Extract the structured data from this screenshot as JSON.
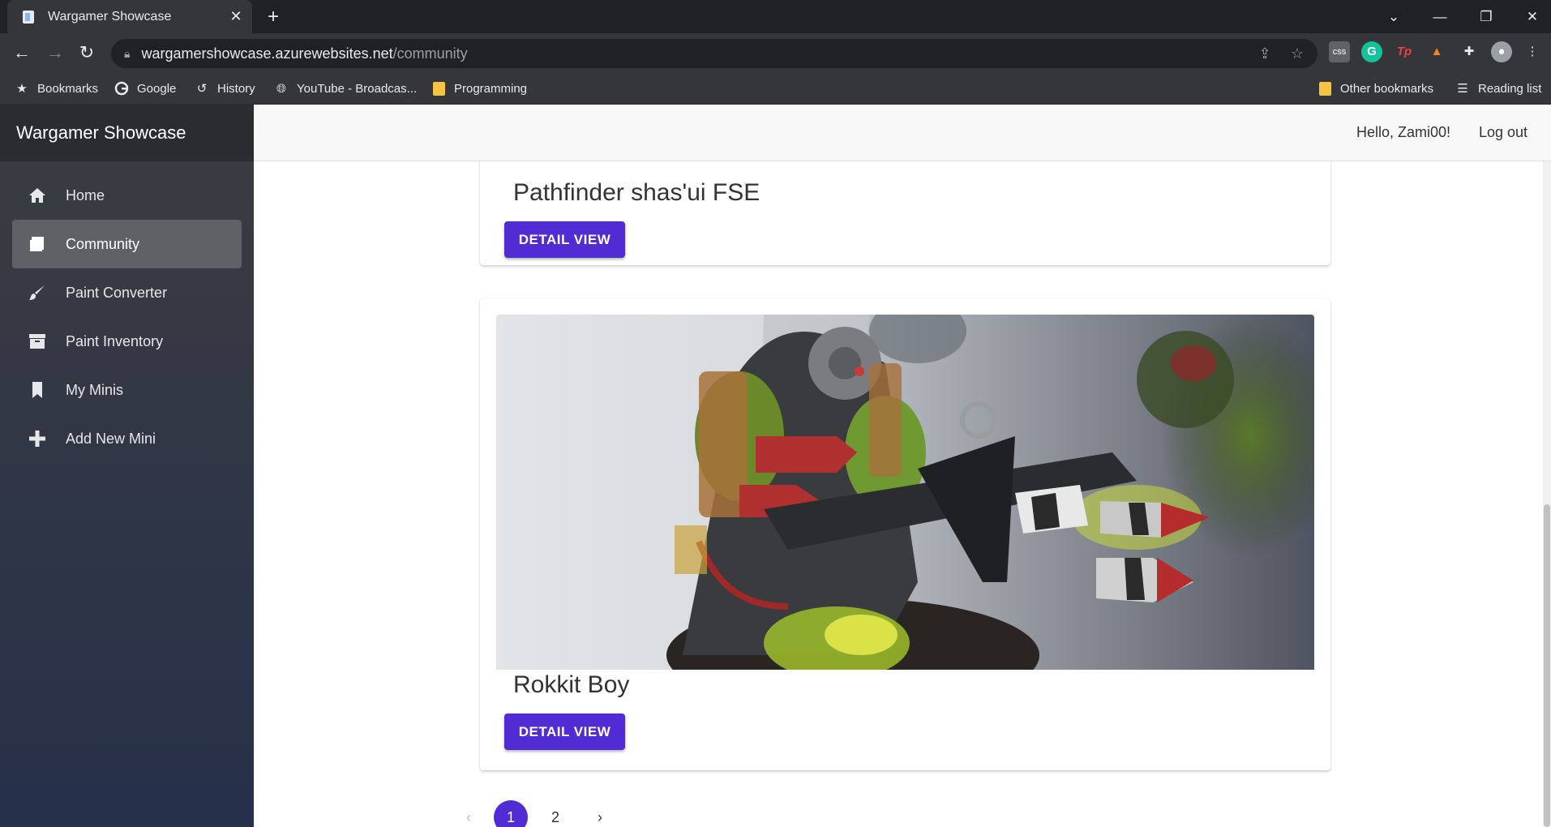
{
  "browser": {
    "tab_title": "Wargamer Showcase",
    "url_host": "wargamershowcase.azurewebsites.net",
    "url_path": "/community",
    "bookmarks": [
      {
        "label": "Bookmarks",
        "icon": "star-icon"
      },
      {
        "label": "Google",
        "icon": "google-icon"
      },
      {
        "label": "History",
        "icon": "history-icon"
      },
      {
        "label": "YouTube - Broadcas...",
        "icon": "globe-icon"
      },
      {
        "label": "Programming",
        "icon": "folder-icon"
      }
    ],
    "other_bookmarks": "Other bookmarks",
    "reading_list": "Reading list"
  },
  "app": {
    "brand": "Wargamer Showcase",
    "greeting": "Hello, Zami00!",
    "logout": "Log out"
  },
  "sidebar": {
    "items": [
      {
        "label": "Home",
        "icon": "home-icon",
        "active": false
      },
      {
        "label": "Community",
        "icon": "book-icon",
        "active": true
      },
      {
        "label": "Paint Converter",
        "icon": "brush-icon",
        "active": false
      },
      {
        "label": "Paint Inventory",
        "icon": "box-icon",
        "active": false
      },
      {
        "label": "My Minis",
        "icon": "bookmark-icon",
        "active": false
      },
      {
        "label": "Add New Mini",
        "icon": "plus-icon",
        "active": false
      }
    ]
  },
  "cards": [
    {
      "title": "Pathfinder shas'ui FSE",
      "button": "DETAIL VIEW"
    },
    {
      "title": "Rokkit Boy",
      "button": "DETAIL VIEW"
    }
  ],
  "pagination": {
    "pages": [
      "1",
      "2"
    ],
    "current": "1"
  },
  "colors": {
    "accent": "#512bd4",
    "sidebar_top": "#3a3d41",
    "sidebar_bottom": "#26304a"
  }
}
